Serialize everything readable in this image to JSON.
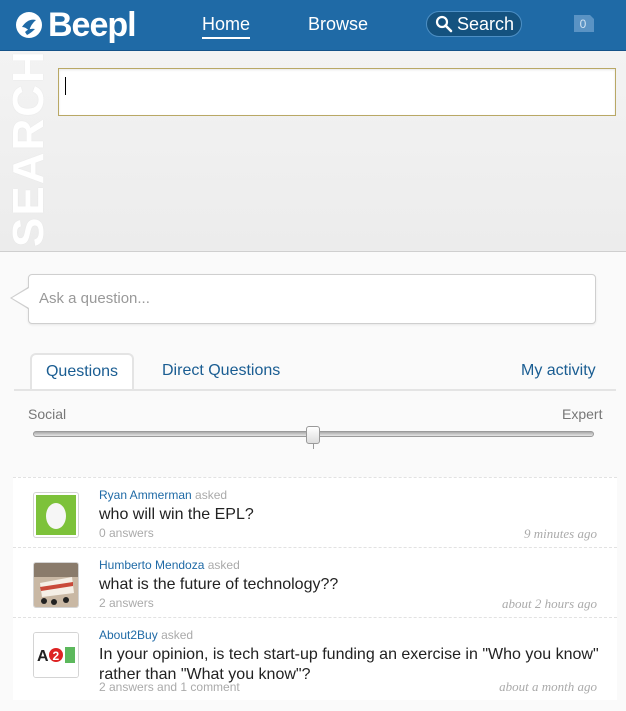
{
  "app": {
    "name": "Beepl",
    "brand_color": "#1f6aa6"
  },
  "nav": {
    "home": "Home",
    "browse": "Browse",
    "search": "Search",
    "notifications_count": "0"
  },
  "search_panel": {
    "side_label": "SEARCH",
    "input_value": ""
  },
  "ask": {
    "placeholder": "Ask a question..."
  },
  "tabs": {
    "questions": "Questions",
    "direct": "Direct Questions",
    "activity": "My activity",
    "active": "Questions"
  },
  "slider": {
    "left_label": "Social",
    "right_label": "Expert",
    "value_fraction": 0.5
  },
  "questions": [
    {
      "user": "Ryan Ammerman",
      "action": "asked",
      "text": "who will win the EPL?",
      "meta": "0 answers",
      "time": "9 minutes ago",
      "avatar_icon": "green-egg-avatar"
    },
    {
      "user": "Humberto Mendoza",
      "action": "asked",
      "text": "what is the future of technology??",
      "meta": "2 answers",
      "time": "about 2 hours ago",
      "avatar_icon": "cake-photo-avatar"
    },
    {
      "user": "About2Buy",
      "action": "asked",
      "text": "In your opinion, is tech start-up funding an exercise in \"Who you know\" rather than \"What you know\"?",
      "meta": "2 answers and 1 comment",
      "time": "about a month ago",
      "avatar_icon": "a2b-logo-avatar"
    }
  ]
}
